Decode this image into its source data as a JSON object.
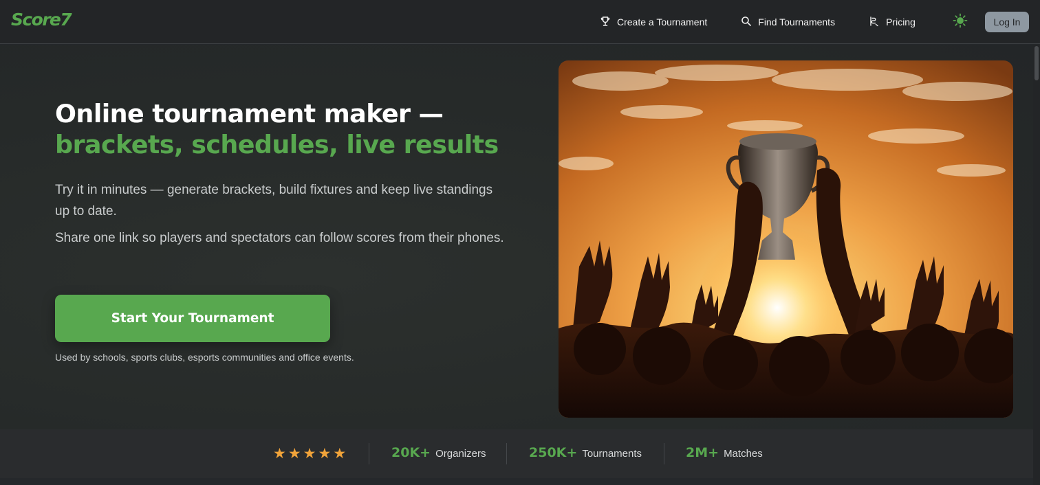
{
  "brand": {
    "logo_text": "Score7",
    "accent_color": "#58a84f"
  },
  "nav": {
    "items": [
      {
        "label": "Create a Tournament",
        "icon": "trophy-icon"
      },
      {
        "label": "Find Tournaments",
        "icon": "search-icon"
      },
      {
        "label": "Pricing",
        "icon": "dollar-icon"
      }
    ],
    "theme_toggle_icon": "sun-icon",
    "login_label": "Log In"
  },
  "hero": {
    "title_line1": "Online tournament maker —",
    "title_line2": "brackets, schedules, live results",
    "description_1": "Try it in minutes — generate brackets, build fixtures and keep live standings up to date.",
    "description_2": "Share one link so players and spectators can follow scores from their phones.",
    "cta_label": "Start Your Tournament",
    "used_by": "Used by schools, sports clubs, esports communities and office events.",
    "image": "trophy-celebration-sunset"
  },
  "stats": {
    "rating_stars": 5,
    "star_color": "#f0a33a",
    "items": [
      {
        "value": "20K+",
        "label": "Organizers"
      },
      {
        "value": "250K+",
        "label": "Tournaments"
      },
      {
        "value": "2M+",
        "label": "Matches"
      }
    ]
  }
}
